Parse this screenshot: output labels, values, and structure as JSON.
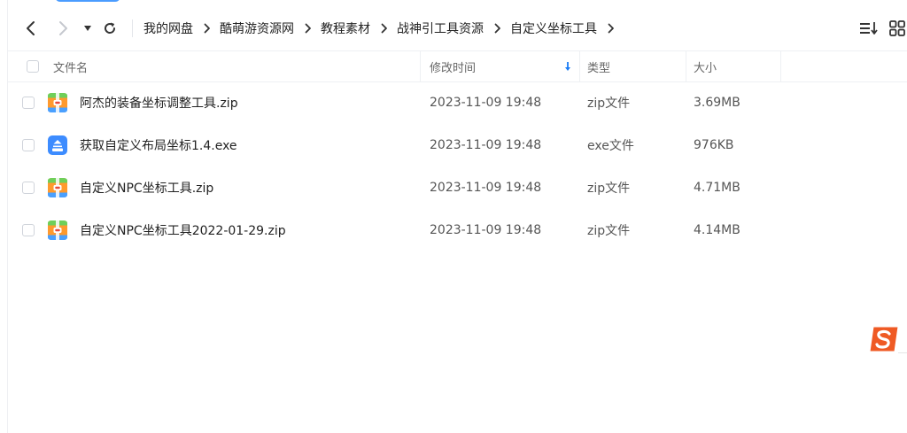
{
  "breadcrumb": [
    "我的网盘",
    "酷萌游资源网",
    "教程素材",
    "战神引工具资源",
    "自定义坐标工具"
  ],
  "columns": {
    "name": "文件名",
    "modified": "修改时间",
    "type": "类型",
    "size": "大小"
  },
  "files": [
    {
      "name": "阿杰的装备坐标调整工具.zip",
      "modified": "2023-11-09 19:48",
      "type": "zip文件",
      "size": "3.69MB",
      "icon": "zip-archive-icon"
    },
    {
      "name": "获取自定义布局坐标1.4.exe",
      "modified": "2023-11-09 19:48",
      "type": "exe文件",
      "size": "976KB",
      "icon": "exe-file-icon"
    },
    {
      "name": "自定义NPC坐标工具.zip",
      "modified": "2023-11-09 19:48",
      "type": "zip文件",
      "size": "4.71MB",
      "icon": "zip-archive-icon"
    },
    {
      "name": "自定义NPC坐标工具2022-01-29.zip",
      "modified": "2023-11-09 19:48",
      "type": "zip文件",
      "size": "4.14MB",
      "icon": "zip-archive-icon"
    }
  ],
  "colors": {
    "accent": "#1a7cf5",
    "ime_brand": "#ef5a24"
  }
}
